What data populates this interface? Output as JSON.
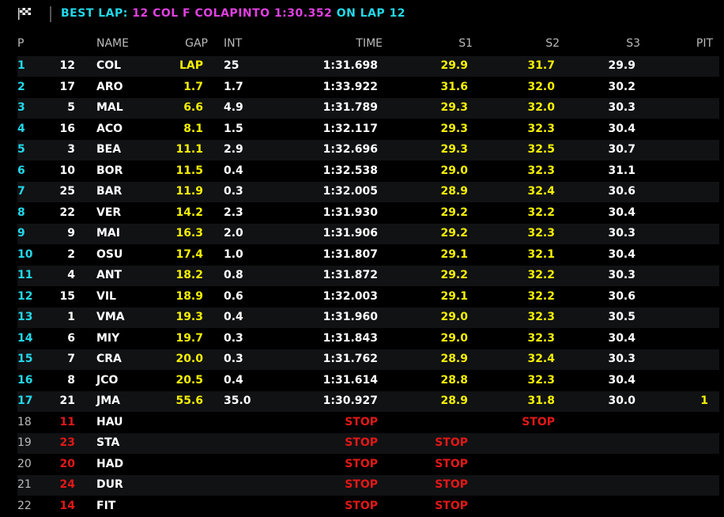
{
  "header": {
    "best_label": "BEST LAP:",
    "best_info": "12 COL F COLAPINTO 1:30.352",
    "on_lap": "ON LAP 12"
  },
  "columns": {
    "p": "P",
    "name": "NAME",
    "gap": "GAP",
    "int": "INT",
    "time": "TIME",
    "s1": "S1",
    "s2": "S2",
    "s3": "S3",
    "pit": "PIT"
  },
  "rows": [
    {
      "p": "1",
      "num": "12",
      "name": "COL",
      "gap": "LAP",
      "int": "25",
      "time": "1:31.698",
      "s1": "29.9",
      "s2": "31.7",
      "s3": "29.9",
      "pit": ""
    },
    {
      "p": "2",
      "num": "17",
      "name": "ARO",
      "gap": "1.7",
      "int": "1.7",
      "time": "1:33.922",
      "s1": "31.6",
      "s2": "32.0",
      "s3": "30.2",
      "pit": ""
    },
    {
      "p": "3",
      "num": "5",
      "name": "MAL",
      "gap": "6.6",
      "int": "4.9",
      "time": "1:31.789",
      "s1": "29.3",
      "s2": "32.0",
      "s3": "30.3",
      "pit": ""
    },
    {
      "p": "4",
      "num": "16",
      "name": "ACO",
      "gap": "8.1",
      "int": "1.5",
      "time": "1:32.117",
      "s1": "29.3",
      "s2": "32.3",
      "s3": "30.4",
      "pit": ""
    },
    {
      "p": "5",
      "num": "3",
      "name": "BEA",
      "gap": "11.1",
      "int": "2.9",
      "time": "1:32.696",
      "s1": "29.3",
      "s2": "32.5",
      "s3": "30.7",
      "pit": ""
    },
    {
      "p": "6",
      "num": "10",
      "name": "BOR",
      "gap": "11.5",
      "int": "0.4",
      "time": "1:32.538",
      "s1": "29.0",
      "s2": "32.3",
      "s3": "31.1",
      "pit": ""
    },
    {
      "p": "7",
      "num": "25",
      "name": "BAR",
      "gap": "11.9",
      "int": "0.3",
      "time": "1:32.005",
      "s1": "28.9",
      "s2": "32.4",
      "s3": "30.6",
      "pit": ""
    },
    {
      "p": "8",
      "num": "22",
      "name": "VER",
      "gap": "14.2",
      "int": "2.3",
      "time": "1:31.930",
      "s1": "29.2",
      "s2": "32.2",
      "s3": "30.4",
      "pit": ""
    },
    {
      "p": "9",
      "num": "9",
      "name": "MAI",
      "gap": "16.3",
      "int": "2.0",
      "time": "1:31.906",
      "s1": "29.2",
      "s2": "32.3",
      "s3": "30.3",
      "pit": ""
    },
    {
      "p": "10",
      "num": "2",
      "name": "OSU",
      "gap": "17.4",
      "int": "1.0",
      "time": "1:31.807",
      "s1": "29.1",
      "s2": "32.1",
      "s3": "30.4",
      "pit": ""
    },
    {
      "p": "11",
      "num": "4",
      "name": "ANT",
      "gap": "18.2",
      "int": "0.8",
      "time": "1:31.872",
      "s1": "29.2",
      "s2": "32.2",
      "s3": "30.3",
      "pit": ""
    },
    {
      "p": "12",
      "num": "15",
      "name": "VIL",
      "gap": "18.9",
      "int": "0.6",
      "time": "1:32.003",
      "s1": "29.1",
      "s2": "32.2",
      "s3": "30.6",
      "pit": ""
    },
    {
      "p": "13",
      "num": "1",
      "name": "VMA",
      "gap": "19.3",
      "int": "0.4",
      "time": "1:31.960",
      "s1": "29.0",
      "s2": "32.3",
      "s3": "30.5",
      "pit": ""
    },
    {
      "p": "14",
      "num": "6",
      "name": "MIY",
      "gap": "19.7",
      "int": "0.3",
      "time": "1:31.843",
      "s1": "29.0",
      "s2": "32.3",
      "s3": "30.4",
      "pit": ""
    },
    {
      "p": "15",
      "num": "7",
      "name": "CRA",
      "gap": "20.0",
      "int": "0.3",
      "time": "1:31.762",
      "s1": "28.9",
      "s2": "32.4",
      "s3": "30.3",
      "pit": ""
    },
    {
      "p": "16",
      "num": "8",
      "name": "JCO",
      "gap": "20.5",
      "int": "0.4",
      "time": "1:31.614",
      "s1": "28.8",
      "s2": "32.3",
      "s3": "30.4",
      "pit": ""
    },
    {
      "p": "17",
      "num": "21",
      "name": "JMA",
      "gap": "55.6",
      "int": "35.0",
      "time": "1:30.927",
      "s1": "28.9",
      "s2": "31.8",
      "s3": "30.0",
      "pit": "1"
    },
    {
      "p": "18",
      "num": "11",
      "name": "HAU",
      "gap": "",
      "int": "",
      "time": "STOP",
      "s1": "",
      "s2": "STOP",
      "s3": "",
      "pit": "",
      "stopped": true
    },
    {
      "p": "19",
      "num": "23",
      "name": "STA",
      "gap": "",
      "int": "",
      "time": "STOP",
      "s1": "STOP",
      "s2": "",
      "s3": "",
      "pit": "",
      "stopped": true
    },
    {
      "p": "20",
      "num": "20",
      "name": "HAD",
      "gap": "",
      "int": "",
      "time": "STOP",
      "s1": "STOP",
      "s2": "",
      "s3": "",
      "pit": "",
      "stopped": true
    },
    {
      "p": "21",
      "num": "24",
      "name": "DUR",
      "gap": "",
      "int": "",
      "time": "STOP",
      "s1": "STOP",
      "s2": "",
      "s3": "",
      "pit": "",
      "stopped": true
    },
    {
      "p": "22",
      "num": "14",
      "name": "FIT",
      "gap": "",
      "int": "",
      "time": "STOP",
      "s1": "STOP",
      "s2": "",
      "s3": "",
      "pit": "",
      "stopped": true
    }
  ]
}
